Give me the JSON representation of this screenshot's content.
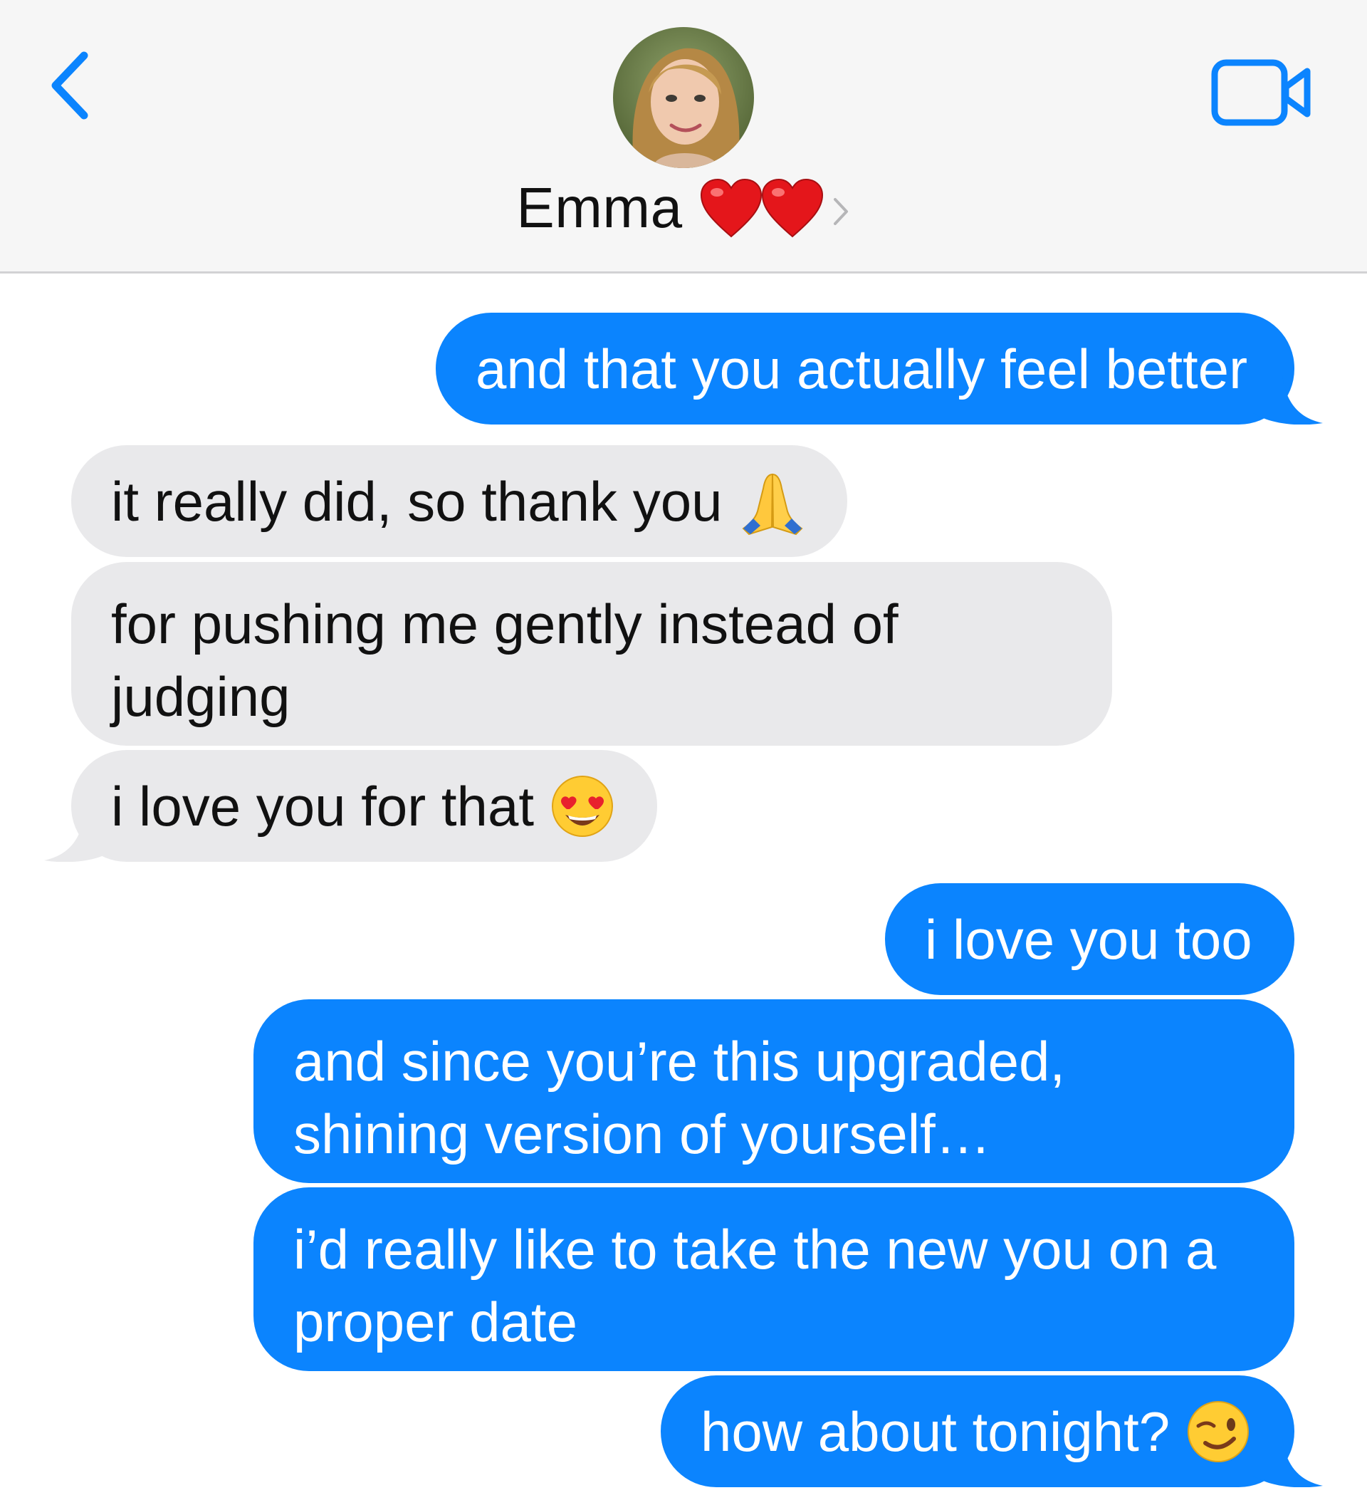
{
  "header": {
    "contact_name": "Emma",
    "icons": {
      "back": "chevron-left-icon",
      "hearts": [
        "red-heart-icon",
        "red-heart-icon"
      ],
      "disclosure": "chevron-right-icon",
      "video": "video-camera-icon"
    },
    "accent_color": "#0b84fe"
  },
  "messages": [
    {
      "direction": "sent",
      "lines": [
        "and that you actually feel better"
      ]
    },
    {
      "direction": "received",
      "lines": [
        "it really did, so thank you"
      ],
      "emoji": "folded-hands-emoji"
    },
    {
      "direction": "received",
      "lines": [
        "for pushing me gently instead of",
        "judging"
      ]
    },
    {
      "direction": "received",
      "lines": [
        "i love you for that"
      ],
      "emoji": "heart-eyes-emoji"
    },
    {
      "direction": "sent",
      "lines": [
        "i love you too"
      ]
    },
    {
      "direction": "sent",
      "lines": [
        "and since you’re this upgraded,",
        "shining version of yourself…"
      ]
    },
    {
      "direction": "sent",
      "lines": [
        "i’d really like to take the new you on a",
        "proper date"
      ]
    },
    {
      "direction": "sent",
      "lines": [
        "how about tonight?"
      ],
      "emoji": "winking-face-emoji"
    }
  ],
  "colors": {
    "sent_bubble": "#0b84fe",
    "received_bubble": "#e9e9eb",
    "header_background": "#f6f6f6"
  }
}
